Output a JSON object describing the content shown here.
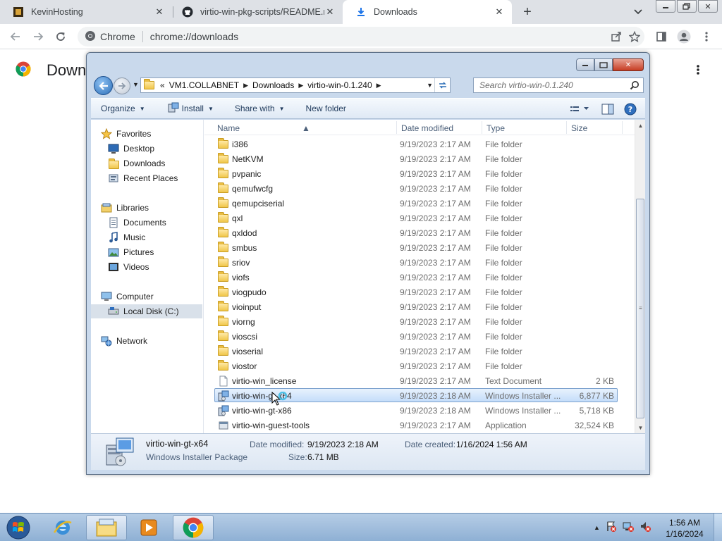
{
  "browser": {
    "tabs": [
      {
        "title": "KevinHosting",
        "icon": "kevinhosting-favicon"
      },
      {
        "title": "virtio-win-pkg-scripts/README.m",
        "icon": "github-icon"
      },
      {
        "title": "Downloads",
        "icon": "download-icon"
      }
    ],
    "new_tab": "+",
    "omnibox": {
      "chip": "Chrome",
      "url": "chrome://downloads"
    },
    "page_title": "Downloads"
  },
  "explorer": {
    "breadcrumb": [
      "VM1.COLLABNET",
      "Downloads",
      "virtio-win-0.1.240"
    ],
    "breadcrumb_prefix": "«",
    "search_placeholder": "Search virtio-win-0.1.240",
    "commands": {
      "organize": "Organize",
      "install": "Install",
      "share_with": "Share with",
      "new_folder": "New folder"
    },
    "nav": {
      "favorites": "Favorites",
      "desktop": "Desktop",
      "downloads": "Downloads",
      "recent_places": "Recent Places",
      "libraries": "Libraries",
      "documents": "Documents",
      "music": "Music",
      "pictures": "Pictures",
      "videos": "Videos",
      "computer": "Computer",
      "local_disk": "Local Disk (C:)",
      "network": "Network"
    },
    "columns": {
      "name": "Name",
      "date": "Date modified",
      "type": "Type",
      "size": "Size"
    },
    "files": [
      {
        "name": "i386",
        "date": "9/19/2023 2:17 AM",
        "type": "File folder",
        "size": "",
        "kind": "folder"
      },
      {
        "name": "NetKVM",
        "date": "9/19/2023 2:17 AM",
        "type": "File folder",
        "size": "",
        "kind": "folder"
      },
      {
        "name": "pvpanic",
        "date": "9/19/2023 2:17 AM",
        "type": "File folder",
        "size": "",
        "kind": "folder"
      },
      {
        "name": "qemufwcfg",
        "date": "9/19/2023 2:17 AM",
        "type": "File folder",
        "size": "",
        "kind": "folder"
      },
      {
        "name": "qemupciserial",
        "date": "9/19/2023 2:17 AM",
        "type": "File folder",
        "size": "",
        "kind": "folder"
      },
      {
        "name": "qxl",
        "date": "9/19/2023 2:17 AM",
        "type": "File folder",
        "size": "",
        "kind": "folder"
      },
      {
        "name": "qxldod",
        "date": "9/19/2023 2:17 AM",
        "type": "File folder",
        "size": "",
        "kind": "folder"
      },
      {
        "name": "smbus",
        "date": "9/19/2023 2:17 AM",
        "type": "File folder",
        "size": "",
        "kind": "folder"
      },
      {
        "name": "sriov",
        "date": "9/19/2023 2:17 AM",
        "type": "File folder",
        "size": "",
        "kind": "folder"
      },
      {
        "name": "viofs",
        "date": "9/19/2023 2:17 AM",
        "type": "File folder",
        "size": "",
        "kind": "folder"
      },
      {
        "name": "viogpudo",
        "date": "9/19/2023 2:17 AM",
        "type": "File folder",
        "size": "",
        "kind": "folder"
      },
      {
        "name": "vioinput",
        "date": "9/19/2023 2:17 AM",
        "type": "File folder",
        "size": "",
        "kind": "folder"
      },
      {
        "name": "viorng",
        "date": "9/19/2023 2:17 AM",
        "type": "File folder",
        "size": "",
        "kind": "folder"
      },
      {
        "name": "vioscsi",
        "date": "9/19/2023 2:17 AM",
        "type": "File folder",
        "size": "",
        "kind": "folder"
      },
      {
        "name": "vioserial",
        "date": "9/19/2023 2:17 AM",
        "type": "File folder",
        "size": "",
        "kind": "folder"
      },
      {
        "name": "viostor",
        "date": "9/19/2023 2:17 AM",
        "type": "File folder",
        "size": "",
        "kind": "folder"
      },
      {
        "name": "virtio-win_license",
        "date": "9/19/2023 2:17 AM",
        "type": "Text Document",
        "size": "2 KB",
        "kind": "text"
      },
      {
        "name": "virtio-win-gt-x64",
        "date": "9/19/2023 2:18 AM",
        "type": "Windows Installer ...",
        "size": "6,877 KB",
        "kind": "msi",
        "selected": true
      },
      {
        "name": "virtio-win-gt-x86",
        "date": "9/19/2023 2:18 AM",
        "type": "Windows Installer ...",
        "size": "5,718 KB",
        "kind": "msi"
      },
      {
        "name": "virtio-win-guest-tools",
        "date": "9/19/2023 2:17 AM",
        "type": "Application",
        "size": "32,524 KB",
        "kind": "exe"
      }
    ],
    "details": {
      "name": "virtio-win-gt-x64",
      "type": "Windows Installer Package",
      "date_modified_label": "Date modified:",
      "date_modified": "9/19/2023 2:18 AM",
      "size_label": "Size:",
      "size": "6.71 MB",
      "date_created_label": "Date created:",
      "date_created": "1/16/2024 1:56 AM"
    }
  },
  "taskbar": {
    "time": "1:56 AM",
    "date": "1/16/2024"
  }
}
